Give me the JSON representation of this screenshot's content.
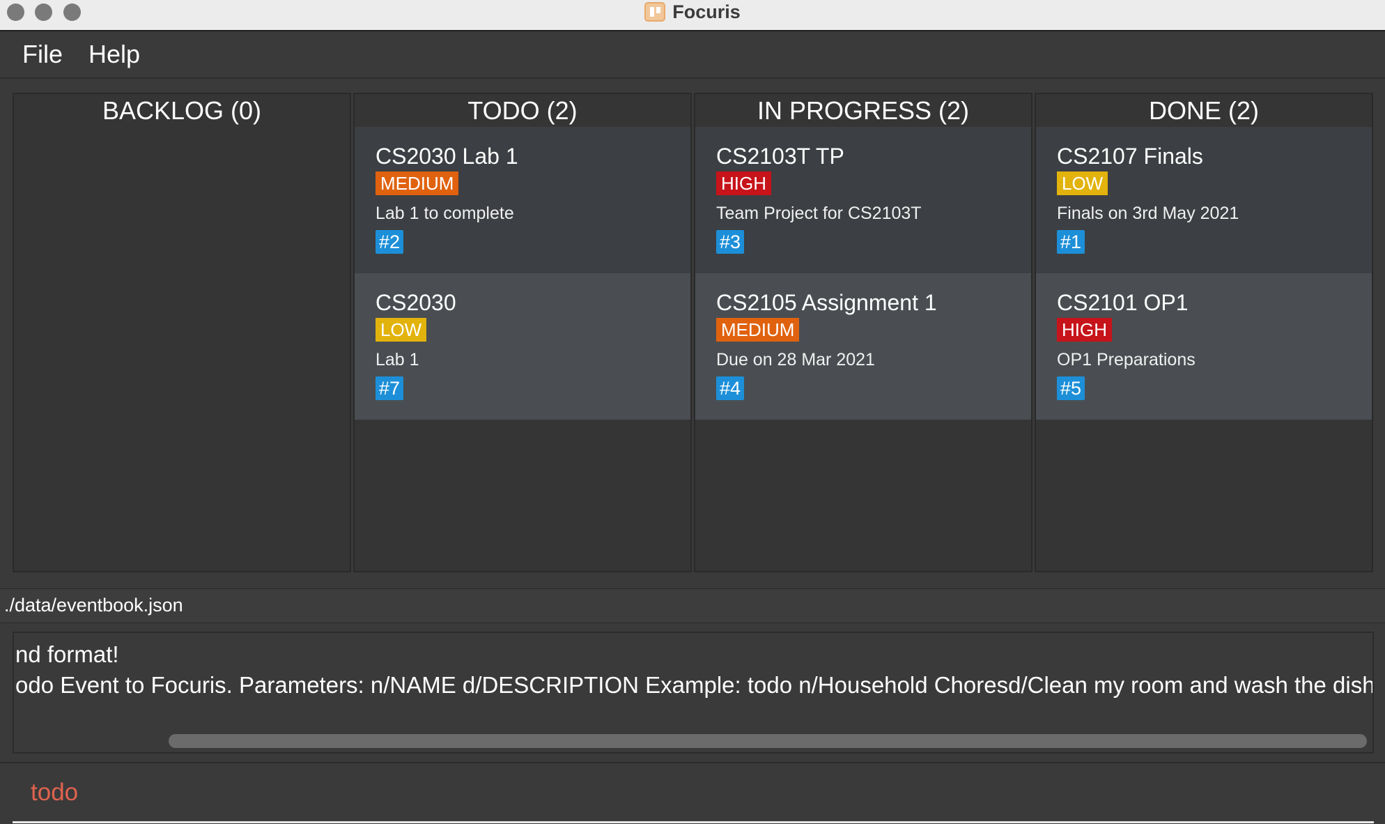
{
  "window": {
    "title": "Focuris"
  },
  "menu": {
    "file": "File",
    "help": "Help"
  },
  "columns": [
    {
      "header": "BACKLOG (0)",
      "cards": []
    },
    {
      "header": "TODO (2)",
      "cards": [
        {
          "title": "CS2030 Lab 1",
          "priority": "MEDIUM",
          "description": "Lab 1 to complete",
          "id": "#2"
        },
        {
          "title": "CS2030",
          "priority": "LOW",
          "description": "Lab 1",
          "id": "#7"
        }
      ]
    },
    {
      "header": "IN PROGRESS (2)",
      "cards": [
        {
          "title": "CS2103T TP",
          "priority": "HIGH",
          "description": "Team Project for CS2103T",
          "id": "#3"
        },
        {
          "title": "CS2105 Assignment 1",
          "priority": "MEDIUM",
          "description": "Due on 28 Mar 2021",
          "id": "#4"
        }
      ]
    },
    {
      "header": "DONE (2)",
      "cards": [
        {
          "title": "CS2107 Finals",
          "priority": "LOW",
          "description": "Finals on 3rd May 2021",
          "id": "#1"
        },
        {
          "title": "CS2101 OP1",
          "priority": "HIGH",
          "description": "OP1 Preparations",
          "id": "#5"
        }
      ]
    }
  ],
  "status": {
    "file_path": "./data/eventbook.json"
  },
  "result": {
    "line1": "nd format!",
    "line2": "odo Event to Focuris. Parameters: n/NAME d/DESCRIPTION Example: todo n/Household Choresd/Clean my room and wash the dishes"
  },
  "command": {
    "value": "todo"
  },
  "colors": {
    "priority_high": "#c7131a",
    "priority_medium": "#e0620f",
    "priority_low": "#e2b30c",
    "id_badge": "#1d8fd8",
    "command_text": "#e0634f"
  }
}
